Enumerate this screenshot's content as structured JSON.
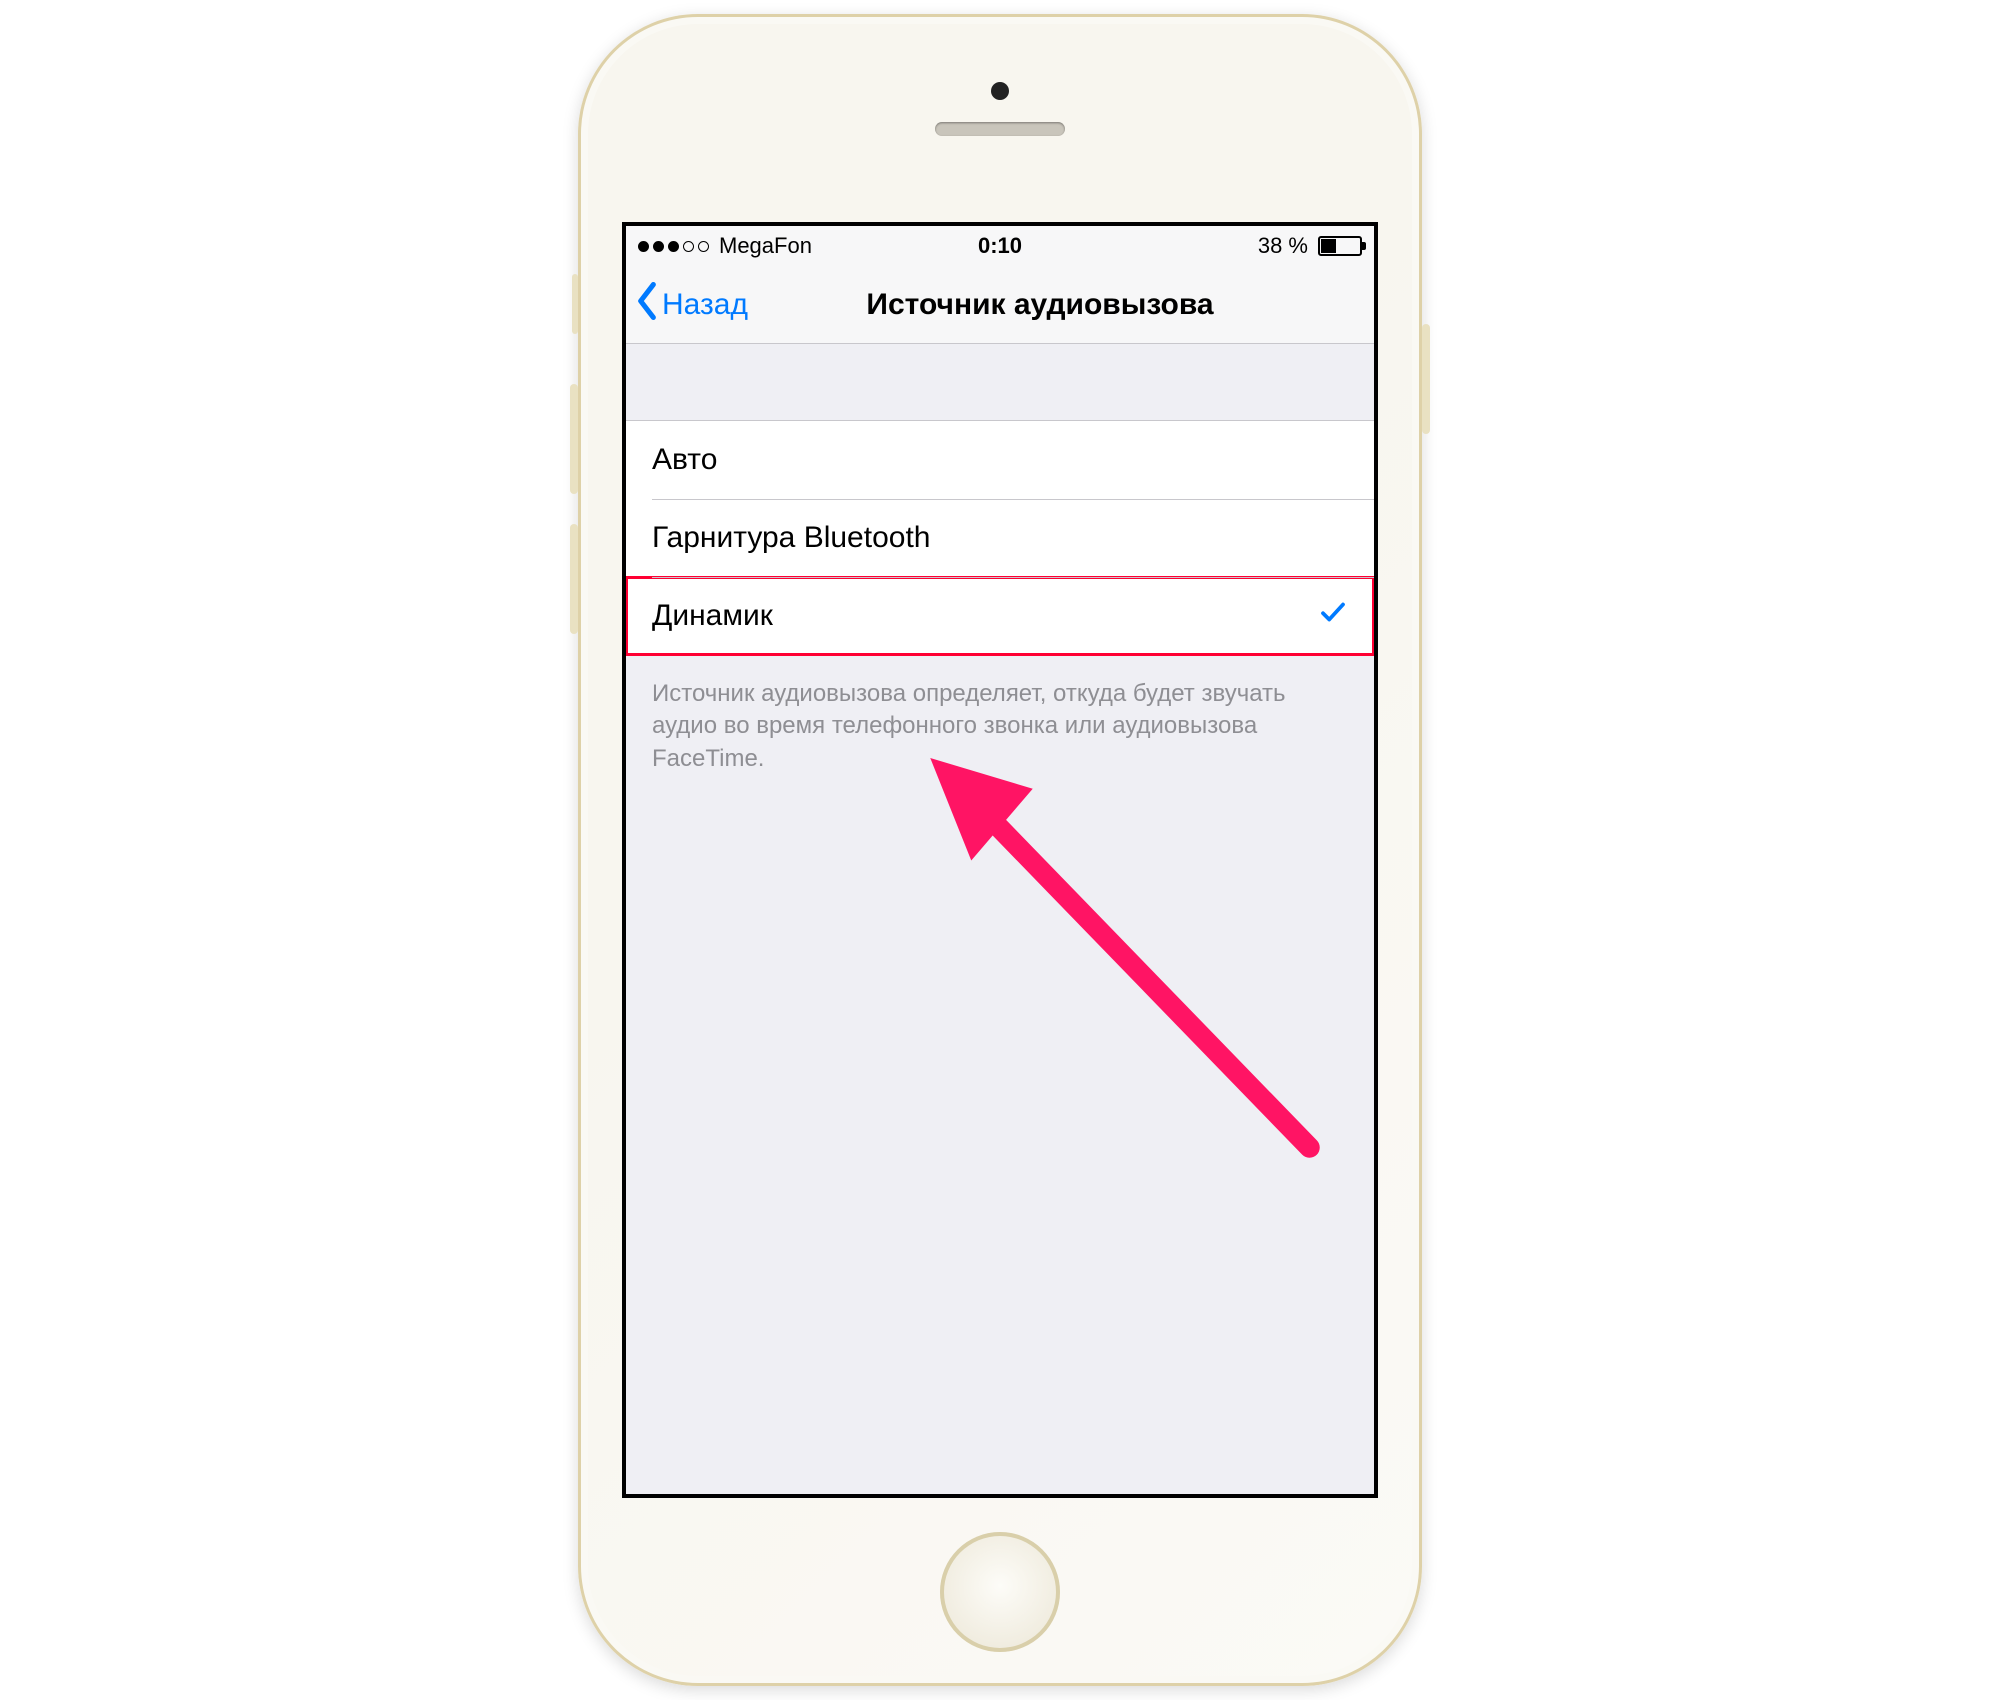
{
  "status": {
    "carrier": "MegaFon",
    "time": "0:10",
    "battery_pct": "38 %"
  },
  "nav": {
    "back_label": "Назад",
    "title": "Источник аудиовызова"
  },
  "options": [
    {
      "label": "Авто",
      "selected": false,
      "highlighted": false
    },
    {
      "label": "Гарнитура Bluetooth",
      "selected": false,
      "highlighted": false
    },
    {
      "label": "Динамик",
      "selected": true,
      "highlighted": true
    }
  ],
  "footer": "Источник аудиовызова определяет, откуда будет звучать аудио во время телефонного звонка или аудиовызова FaceTime."
}
